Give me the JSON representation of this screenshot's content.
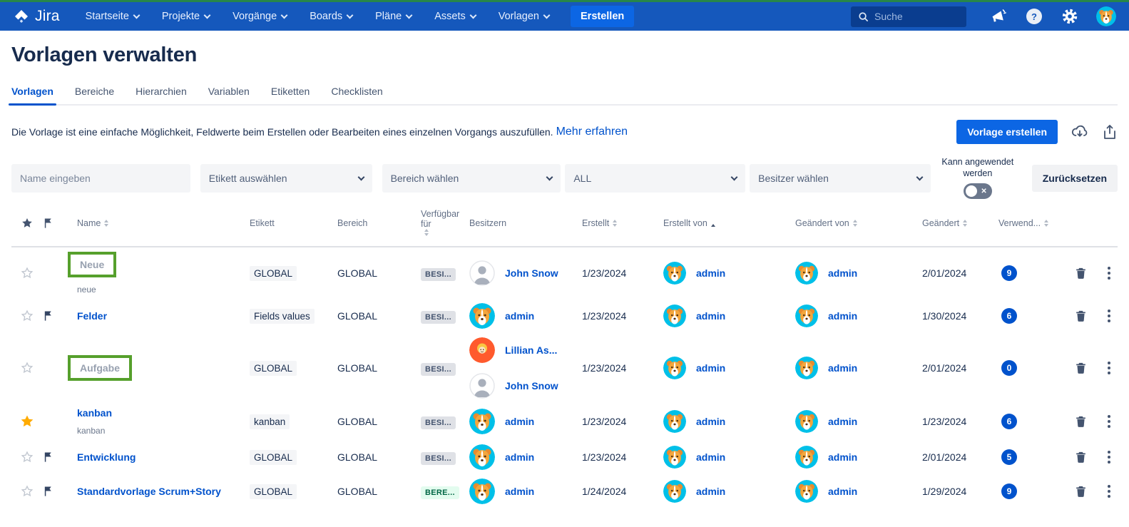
{
  "colors": {
    "navbar_bg": "#1558BC",
    "create_button_bg": "#0C66E4",
    "link_blue": "#0052CC",
    "highlight_green": "#56A02C",
    "starred_yellow": "#FFAB00",
    "count_badge_bg": "#0052CC",
    "available_gray_bg": "#DFE1E6",
    "available_green_bg": "#E3FCEF",
    "available_green_text": "#006644",
    "avatar_teal": "#00C0E8",
    "avatar_orange": "#FF5A2D"
  },
  "navbar": {
    "logo_text": "Jira",
    "items": [
      {
        "label": "Startseite"
      },
      {
        "label": "Projekte"
      },
      {
        "label": "Vorgänge"
      },
      {
        "label": "Boards"
      },
      {
        "label": "Pläne"
      },
      {
        "label": "Assets"
      },
      {
        "label": "Vorlagen"
      }
    ],
    "create_button": "Erstellen",
    "search": {
      "placeholder": "Suche"
    }
  },
  "page": {
    "title": "Vorlagen verwalten"
  },
  "tabs": [
    {
      "label": "Vorlagen",
      "active": true
    },
    {
      "label": "Bereiche"
    },
    {
      "label": "Hierarchien"
    },
    {
      "label": "Variablen"
    },
    {
      "label": "Etiketten"
    },
    {
      "label": "Checklisten"
    }
  ],
  "intro": {
    "text": "Die Vorlage ist eine einfache Möglichkeit, Feldwerte beim Erstellen oder Bearbeiten eines einzelnen Vorgangs auszufüllen.",
    "link": "Mehr erfahren",
    "create_button": "Vorlage erstellen"
  },
  "filters": {
    "name_placeholder": "Name eingeben",
    "label_select": "Etikett auswählen",
    "scope_select": "Bereich wählen",
    "type_select": "ALL",
    "owner_select": "Besitzer wählen",
    "can_apply_label": "Kann angewendet werden",
    "toggle_state": "off",
    "reset_button": "Zurücksetzen"
  },
  "table": {
    "headers": {
      "name": "Name",
      "label": "Etikett",
      "scope": "Bereich",
      "available": "Verfügbar für",
      "owners": "Besitzern",
      "created": "Erstellt",
      "created_by": "Erstellt von",
      "modified_by": "Geändert von",
      "modified": "Geändert",
      "used": "Verwend..."
    },
    "sort": {
      "active_column": "created_by",
      "direction": "asc"
    },
    "rows": [
      {
        "starred": false,
        "flagged": false,
        "name": "Neue",
        "name_muted": true,
        "highlighted": true,
        "subtitle": "neue",
        "label": "GLOBAL",
        "scope": "GLOBAL",
        "available": "BESI...",
        "available_type": "gray",
        "owners": [
          {
            "name": "John Snow",
            "avatar": "person-avatar"
          }
        ],
        "created": "1/23/2024",
        "created_by": "admin",
        "modified_by": "admin",
        "modified": "2/01/2024",
        "used": "9"
      },
      {
        "starred": false,
        "flagged": true,
        "name": "Felder",
        "name_muted": false,
        "highlighted": false,
        "subtitle": "",
        "label": "Fields values",
        "scope": "GLOBAL",
        "available": "BESI...",
        "available_type": "gray",
        "owners": [
          {
            "name": "admin",
            "avatar": "dog-avatar"
          }
        ],
        "created": "1/23/2024",
        "created_by": "admin",
        "modified_by": "admin",
        "modified": "1/30/2024",
        "used": "6"
      },
      {
        "starred": false,
        "flagged": false,
        "name": "Aufgabe",
        "name_muted": true,
        "highlighted": true,
        "subtitle": "",
        "label": "GLOBAL",
        "scope": "GLOBAL",
        "available": "BESI...",
        "available_type": "gray",
        "owners": [
          {
            "name": "Lillian As...",
            "avatar": "orange-avatar"
          },
          {
            "name": "John Snow",
            "avatar": "person-avatar"
          }
        ],
        "created": "1/23/2024",
        "created_by": "admin",
        "modified_by": "admin",
        "modified": "2/01/2024",
        "used": "0"
      },
      {
        "starred": true,
        "flagged": false,
        "name": "kanban",
        "name_muted": false,
        "highlighted": false,
        "subtitle": "kanban",
        "label": "kanban",
        "scope": "GLOBAL",
        "available": "BESI...",
        "available_type": "gray",
        "owners": [
          {
            "name": "admin",
            "avatar": "dog-avatar"
          }
        ],
        "created": "1/23/2024",
        "created_by": "admin",
        "modified_by": "admin",
        "modified": "1/23/2024",
        "used": "6"
      },
      {
        "starred": false,
        "flagged": true,
        "name": "Entwicklung",
        "name_muted": false,
        "highlighted": false,
        "subtitle": "",
        "label": "GLOBAL",
        "scope": "GLOBAL",
        "available": "BESI...",
        "available_type": "gray",
        "owners": [
          {
            "name": "admin",
            "avatar": "dog-avatar"
          }
        ],
        "created": "1/23/2024",
        "created_by": "admin",
        "modified_by": "admin",
        "modified": "2/01/2024",
        "used": "5"
      },
      {
        "starred": false,
        "flagged": true,
        "name": "Standardvorlage Scrum+Story",
        "name_muted": false,
        "highlighted": false,
        "subtitle": "",
        "label": "GLOBAL",
        "scope": "GLOBAL",
        "available": "BERE...",
        "available_type": "green",
        "owners": [
          {
            "name": "admin",
            "avatar": "dog-avatar"
          }
        ],
        "created": "1/24/2024",
        "created_by": "admin",
        "modified_by": "admin",
        "modified": "1/29/2024",
        "used": "9"
      }
    ]
  }
}
